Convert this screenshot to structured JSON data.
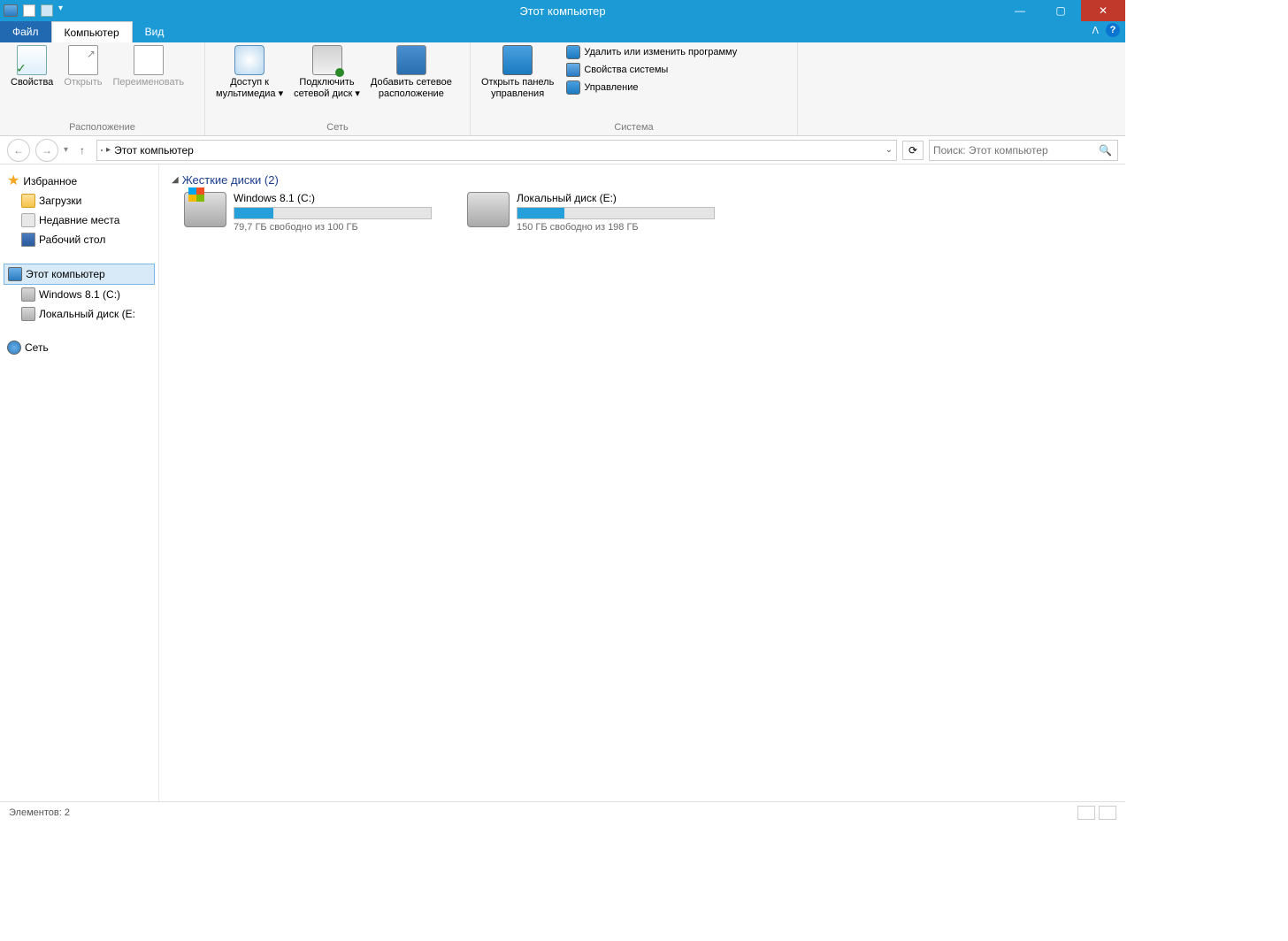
{
  "title": "Этот компьютер",
  "tabs": {
    "file": "Файл",
    "computer": "Компьютер",
    "view": "Вид"
  },
  "ribbon": {
    "location": {
      "label": "Расположение",
      "properties": "Свойства",
      "open": "Открыть",
      "rename": "Переименовать"
    },
    "network": {
      "label": "Сеть",
      "media": "Доступ к\nмультимедиа ▾",
      "mapdrive": "Подключить\nсетевой диск ▾",
      "addloc": "Добавить сетевое\nрасположение"
    },
    "system": {
      "label": "Система",
      "panel": "Открыть панель\nуправления",
      "uninstall": "Удалить или изменить программу",
      "props": "Свойства системы",
      "manage": "Управление"
    }
  },
  "address": {
    "location": "Этот компьютер",
    "dropdown": "▾",
    "search_placeholder": "Поиск: Этот компьютер"
  },
  "sidebar": {
    "fav": "Избранное",
    "fav_items": [
      "Загрузки",
      "Недавние места",
      "Рабочий стол"
    ],
    "pc": "Этот компьютер",
    "pc_items": [
      "Windows 8.1 (C:)",
      "Локальный диск (E:"
    ],
    "net": "Сеть"
  },
  "content": {
    "hdd_header": "Жесткие диски (2)",
    "drives": [
      {
        "name": "Windows 8.1 (C:)",
        "free": "79,7 ГБ свободно из 100 ГБ",
        "used_pct": 20
      },
      {
        "name": "Локальный диск (E:)",
        "free": "150 ГБ свободно из 198 ГБ",
        "used_pct": 24
      }
    ]
  },
  "status": "Элементов: 2"
}
